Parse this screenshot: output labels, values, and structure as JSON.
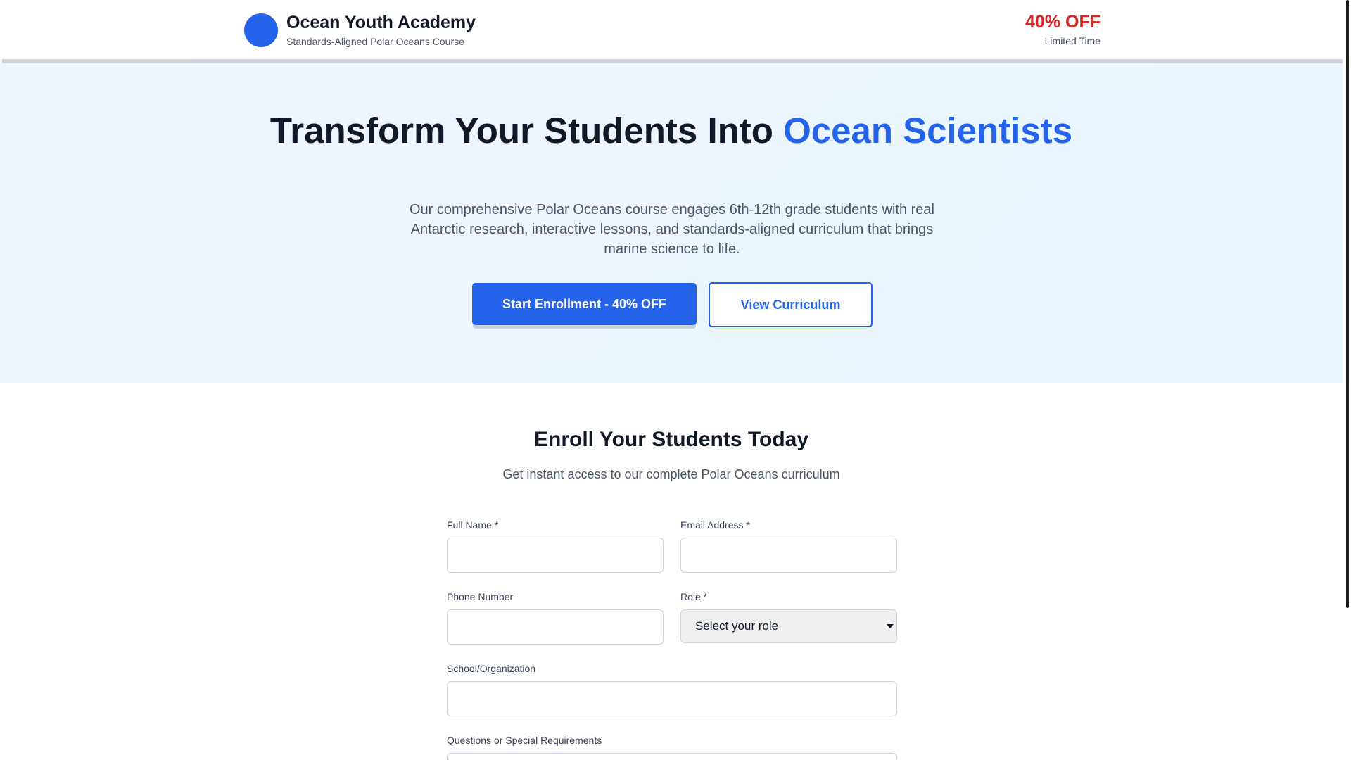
{
  "header": {
    "brand_title": "Ocean Youth Academy",
    "brand_subtitle": "Standards-Aligned Polar Oceans Course",
    "promo_main": "40% OFF",
    "promo_sub": "Limited Time"
  },
  "hero": {
    "title_part1": "Transform Your Students Into ",
    "title_accent": "Ocean Scientists",
    "description": "Our comprehensive Polar Oceans course engages 6th-12th grade students with real Antarctic research, interactive lessons, and standards-aligned curriculum that brings marine science to life.",
    "primary_cta": "Start Enrollment - 40% OFF",
    "secondary_cta": "View Curriculum"
  },
  "enroll": {
    "title": "Enroll Your Students Today",
    "subtitle": "Get instant access to our complete Polar Oceans curriculum",
    "fields": {
      "full_name_label": "Full Name *",
      "full_name_value": "",
      "email_label": "Email Address *",
      "email_value": "",
      "phone_label": "Phone Number",
      "phone_value": "",
      "role_label": "Role *",
      "role_selected": "Select your role",
      "school_label": "School/Organization",
      "school_value": "",
      "questions_label": "Questions or Special Requirements"
    }
  },
  "colors": {
    "accent": "#2563eb",
    "promo": "#dc2626",
    "hero_bg": "#eef6fc"
  }
}
